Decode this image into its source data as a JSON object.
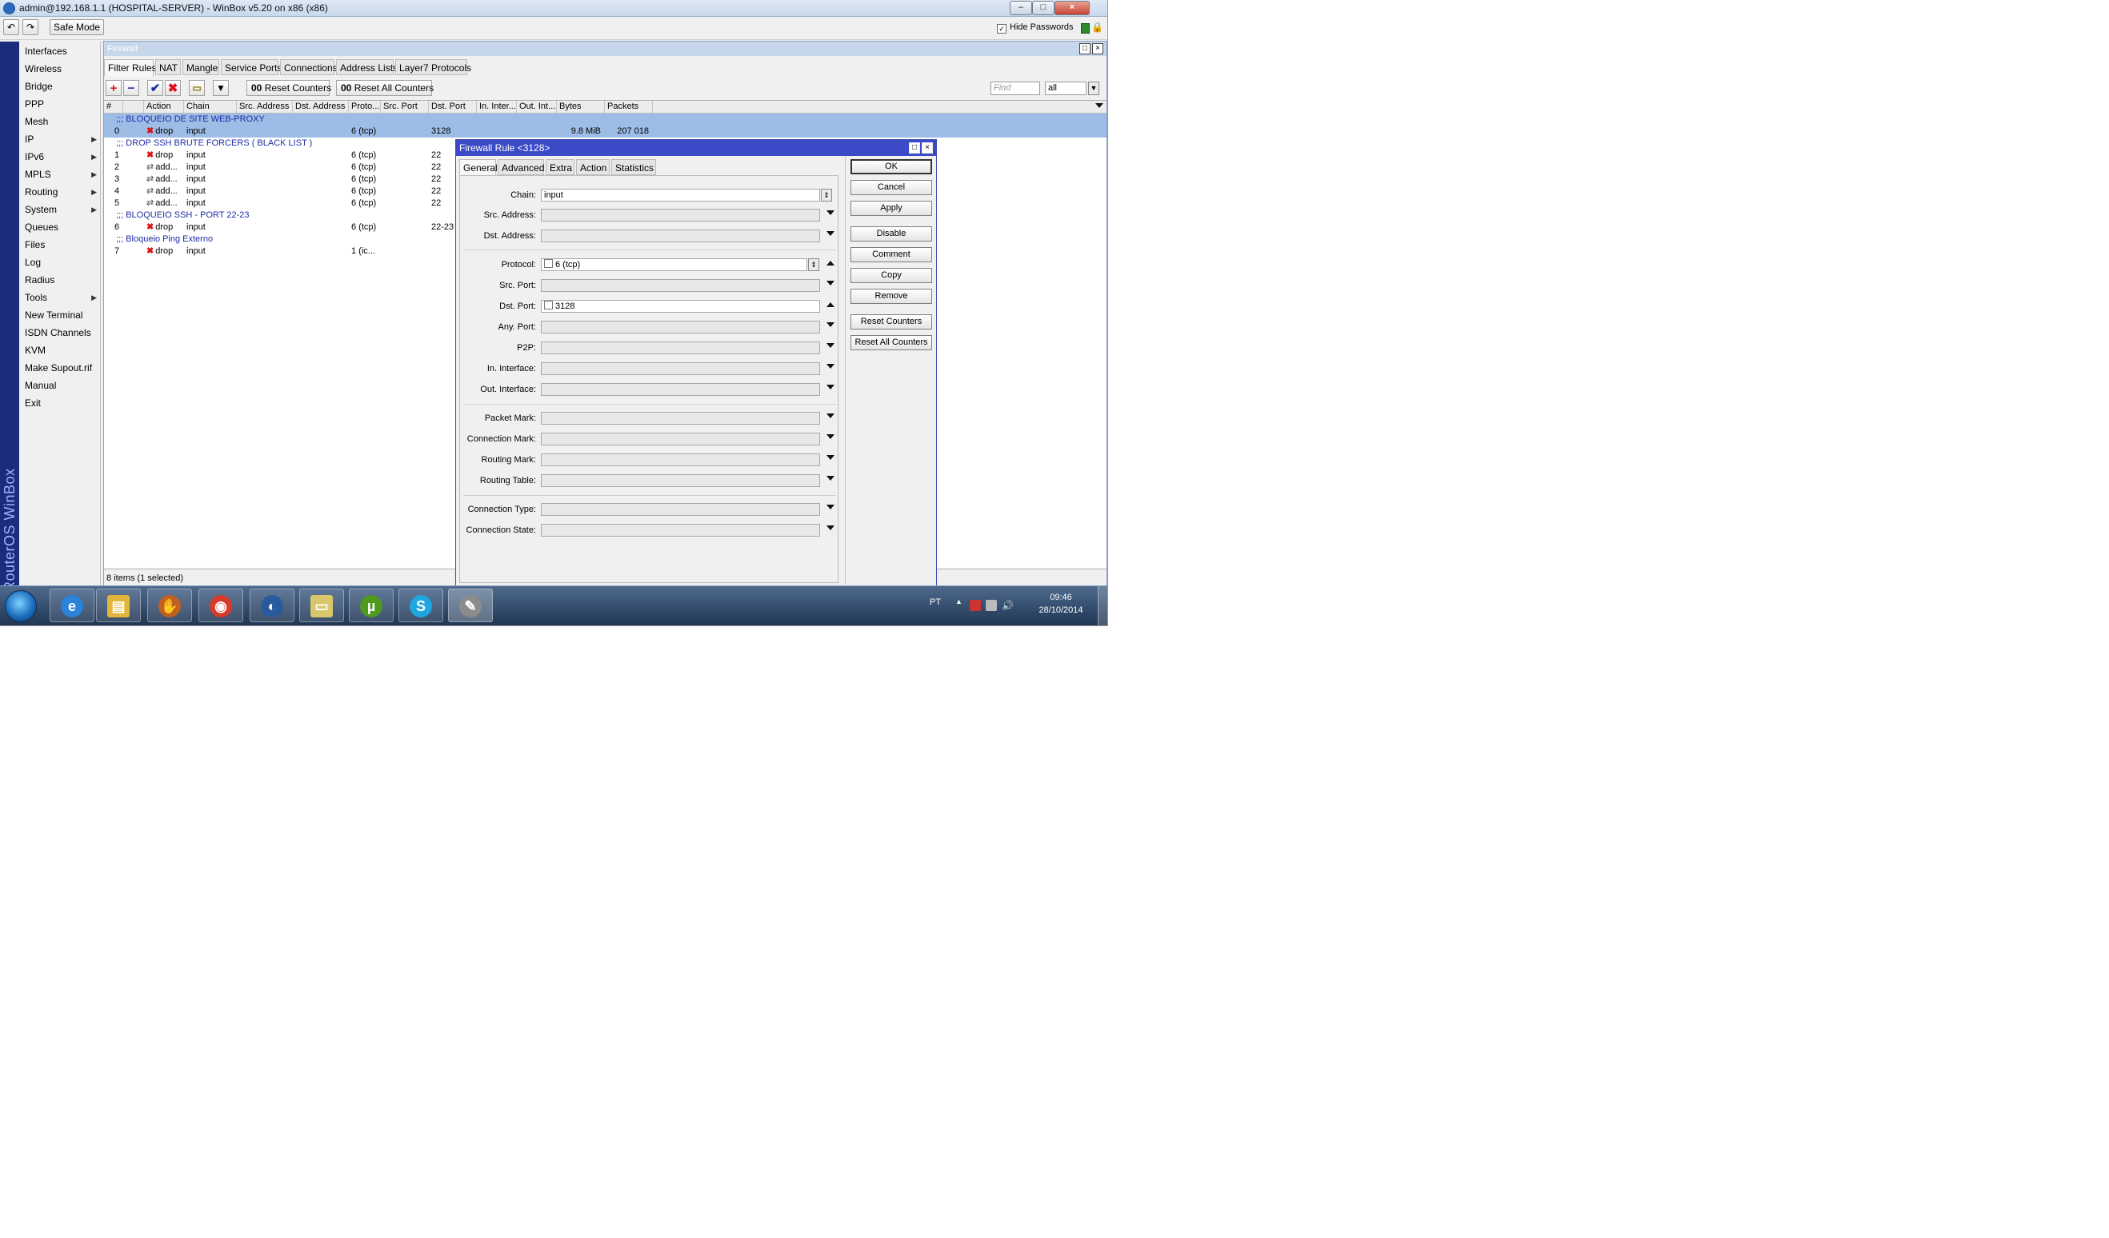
{
  "window": {
    "title": "admin@192.168.1.1 (HOSPITAL-SERVER) - WinBox v5.20 on x86 (x86)",
    "controls": [
      "–",
      "□",
      "×"
    ]
  },
  "toolbar": {
    "undo_icon": "undo-icon",
    "redo_icon": "redo-icon",
    "safe_mode_label": "Safe Mode",
    "hide_passwords_label": "Hide Passwords",
    "hide_passwords_checked": true
  },
  "brand": {
    "text": "RouterOS WinBox",
    "color": "#1b2c7c"
  },
  "sidebar": {
    "items": [
      {
        "label": "Interfaces",
        "submenu": false
      },
      {
        "label": "Wireless",
        "submenu": false
      },
      {
        "label": "Bridge",
        "submenu": false
      },
      {
        "label": "PPP",
        "submenu": false
      },
      {
        "label": "Mesh",
        "submenu": false
      },
      {
        "label": "IP",
        "submenu": true
      },
      {
        "label": "IPv6",
        "submenu": true
      },
      {
        "label": "MPLS",
        "submenu": true
      },
      {
        "label": "Routing",
        "submenu": true
      },
      {
        "label": "System",
        "submenu": true
      },
      {
        "label": "Queues",
        "submenu": false
      },
      {
        "label": "Files",
        "submenu": false
      },
      {
        "label": "Log",
        "submenu": false
      },
      {
        "label": "Radius",
        "submenu": false
      },
      {
        "label": "Tools",
        "submenu": true
      },
      {
        "label": "New Terminal",
        "submenu": false
      },
      {
        "label": "ISDN Channels",
        "submenu": false
      },
      {
        "label": "KVM",
        "submenu": false
      },
      {
        "label": "Make Supout.rif",
        "submenu": false
      },
      {
        "label": "Manual",
        "submenu": false
      },
      {
        "label": "Exit",
        "submenu": false
      }
    ]
  },
  "firewall": {
    "title": "Firewall",
    "tabs": [
      "Filter Rules",
      "NAT",
      "Mangle",
      "Service Ports",
      "Connections",
      "Address Lists",
      "Layer7 Protocols"
    ],
    "active_tab": "Filter Rules",
    "tools": {
      "add_icon": "plus-icon",
      "remove_icon": "minus-icon",
      "enable_icon": "check-icon",
      "disable_icon": "x-icon",
      "comment_icon": "comment-icon",
      "filter_icon": "filter-icon",
      "reset_counters": "Reset Counters",
      "reset_all_counters": "Reset All Counters",
      "counter_glyph": "00",
      "find_placeholder": "Find",
      "find_scope": "all"
    },
    "columns": [
      "#",
      "",
      "Action",
      "Chain",
      "Src. Address",
      "Dst. Address",
      "Proto...",
      "Src. Port",
      "Dst. Port",
      "In. Inter...",
      "Out. Int...",
      "Bytes",
      "Packets"
    ],
    "rows": [
      {
        "type": "comment",
        "text": ";;; BLOQUEIO DE SITE WEB-PROXY"
      },
      {
        "type": "rule",
        "num": "0",
        "action": "drop",
        "chain": "input",
        "proto": "6 (tcp)",
        "dst_port": "3128",
        "bytes": "9.8 MiB",
        "packets": "207 018",
        "selected": true
      },
      {
        "type": "comment",
        "text": ";;; DROP SSH BRUTE FORCERS ( BLACK LIST )"
      },
      {
        "type": "rule",
        "num": "1",
        "action": "drop",
        "chain": "input",
        "proto": "6 (tcp)",
        "dst_port": "22",
        "bytes": "",
        "packets": ""
      },
      {
        "type": "rule",
        "num": "2",
        "action": "add...",
        "chain": "input",
        "proto": "6 (tcp)",
        "dst_port": "22",
        "bytes": "",
        "packets": ""
      },
      {
        "type": "rule",
        "num": "3",
        "action": "add...",
        "chain": "input",
        "proto": "6 (tcp)",
        "dst_port": "22",
        "bytes": "",
        "packets": ""
      },
      {
        "type": "rule",
        "num": "4",
        "action": "add...",
        "chain": "input",
        "proto": "6 (tcp)",
        "dst_port": "22",
        "bytes": "",
        "packets": ""
      },
      {
        "type": "rule",
        "num": "5",
        "action": "add...",
        "chain": "input",
        "proto": "6 (tcp)",
        "dst_port": "22",
        "bytes": "",
        "packets": ""
      },
      {
        "type": "comment",
        "text": ";;; BLOQUEIO SSH - PORT 22-23"
      },
      {
        "type": "rule",
        "num": "6",
        "action": "drop",
        "chain": "input",
        "proto": "6 (tcp)",
        "dst_port": "22-23",
        "bytes": "",
        "packets": ""
      },
      {
        "type": "comment",
        "text": ";;; Bloqueio Ping Externo"
      },
      {
        "type": "rule",
        "num": "7",
        "action": "drop",
        "chain": "input",
        "proto": "1 (ic...",
        "dst_port": "",
        "bytes": "",
        "packets": ""
      }
    ],
    "status": "8 items (1 selected)"
  },
  "rule_dialog": {
    "title": "Firewall Rule <3128>",
    "tabs": [
      "General",
      "Advanced",
      "Extra",
      "Action",
      "Statistics"
    ],
    "active_tab": "General",
    "fields": {
      "chain": {
        "label": "Chain:",
        "value": "input"
      },
      "src_address": {
        "label": "Src. Address:",
        "value": ""
      },
      "dst_address": {
        "label": "Dst. Address:",
        "value": ""
      },
      "protocol": {
        "label": "Protocol:",
        "value": "6 (tcp)"
      },
      "src_port": {
        "label": "Src. Port:",
        "value": ""
      },
      "dst_port": {
        "label": "Dst. Port:",
        "value": "3128"
      },
      "any_port": {
        "label": "Any. Port:",
        "value": ""
      },
      "p2p": {
        "label": "P2P:",
        "value": ""
      },
      "in_interface": {
        "label": "In. Interface:",
        "value": ""
      },
      "out_interface": {
        "label": "Out. Interface:",
        "value": ""
      },
      "packet_mark": {
        "label": "Packet Mark:",
        "value": ""
      },
      "connection_mark": {
        "label": "Connection Mark:",
        "value": ""
      },
      "routing_mark": {
        "label": "Routing Mark:",
        "value": ""
      },
      "routing_table": {
        "label": "Routing Table:",
        "value": ""
      },
      "connection_type": {
        "label": "Connection Type:",
        "value": ""
      },
      "connection_state": {
        "label": "Connection State:",
        "value": ""
      }
    },
    "buttons": {
      "ok": "OK",
      "cancel": "Cancel",
      "apply": "Apply",
      "disable": "Disable",
      "comment": "Comment",
      "copy": "Copy",
      "remove": "Remove",
      "reset_counters": "Reset Counters",
      "reset_all_counters": "Reset All Counters"
    }
  },
  "taskbar": {
    "apps": [
      {
        "name": "internet-explorer-icon",
        "glyph": "e",
        "color": "#2b82d9"
      },
      {
        "name": "file-explorer-icon",
        "glyph": "▤",
        "color": "#e3b53c"
      },
      {
        "name": "gecko-app-icon",
        "glyph": "✋",
        "color": "#c2611f"
      },
      {
        "name": "chrome-icon",
        "glyph": "◉",
        "color": "#d93a2b"
      },
      {
        "name": "thunderbird-icon",
        "glyph": "◐",
        "color": "#2a5a9e"
      },
      {
        "name": "folder-icon",
        "glyph": "▭",
        "color": "#d9c86b"
      },
      {
        "name": "utorrent-icon",
        "glyph": "µ",
        "color": "#4e9a1e"
      },
      {
        "name": "skype-icon",
        "glyph": "S",
        "color": "#1ea6e0"
      },
      {
        "name": "winbox-icon",
        "glyph": "✎",
        "color": "#8c8c8c"
      }
    ],
    "language": "PT",
    "time": "09:46",
    "date": "28/10/2014"
  }
}
